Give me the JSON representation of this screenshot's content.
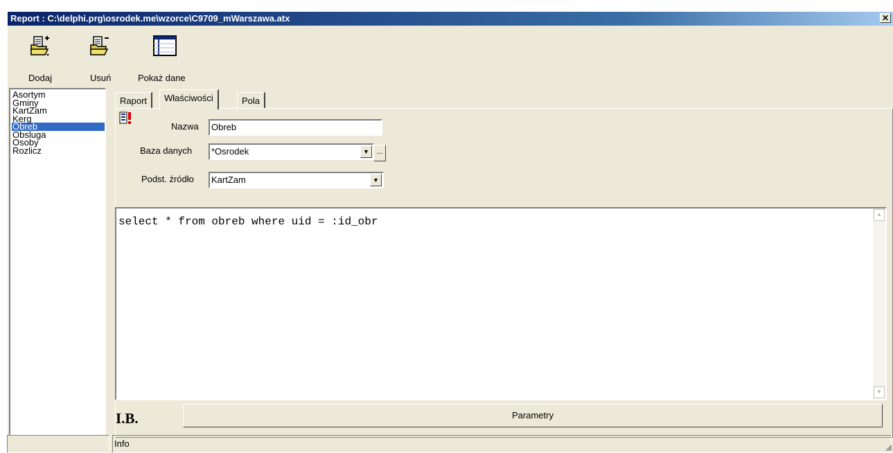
{
  "window": {
    "title": "Report : C:\\delphi.prg\\osrodek.me\\wzorce\\C9709_mWarszawa.atx",
    "close_glyph": "✕"
  },
  "toolbar": {
    "add_label": "Dodaj",
    "remove_label": "Usuń",
    "show_data_label": "Pokaż dane"
  },
  "report_list": {
    "items": [
      "Asortym",
      "Gminy",
      "KartZam",
      "Kerg",
      "Obreb",
      "Obsluga",
      "Osoby",
      "Rozlicz"
    ],
    "selected": "Obreb"
  },
  "tabs": [
    {
      "label": "Raport"
    },
    {
      "label": "Właściwości"
    },
    {
      "label": "Pola"
    }
  ],
  "properties": {
    "name_label": "Nazwa",
    "name_value": "Obreb",
    "database_label": "Baza danych",
    "database_value": "*Osrodek",
    "source_label": "Podst. źródło",
    "source_value": "KartZam",
    "dots_label": "..."
  },
  "sql": {
    "text": "select * from obreb where uid = :id_obr"
  },
  "footer": {
    "initials": "I.B.",
    "params_button": "Parametry"
  },
  "statusbar": {
    "panel1": "",
    "info": "Info"
  },
  "colors": {
    "selection": "#316ac5",
    "title_bar": "#0a246a",
    "face": "#ece9d8"
  }
}
